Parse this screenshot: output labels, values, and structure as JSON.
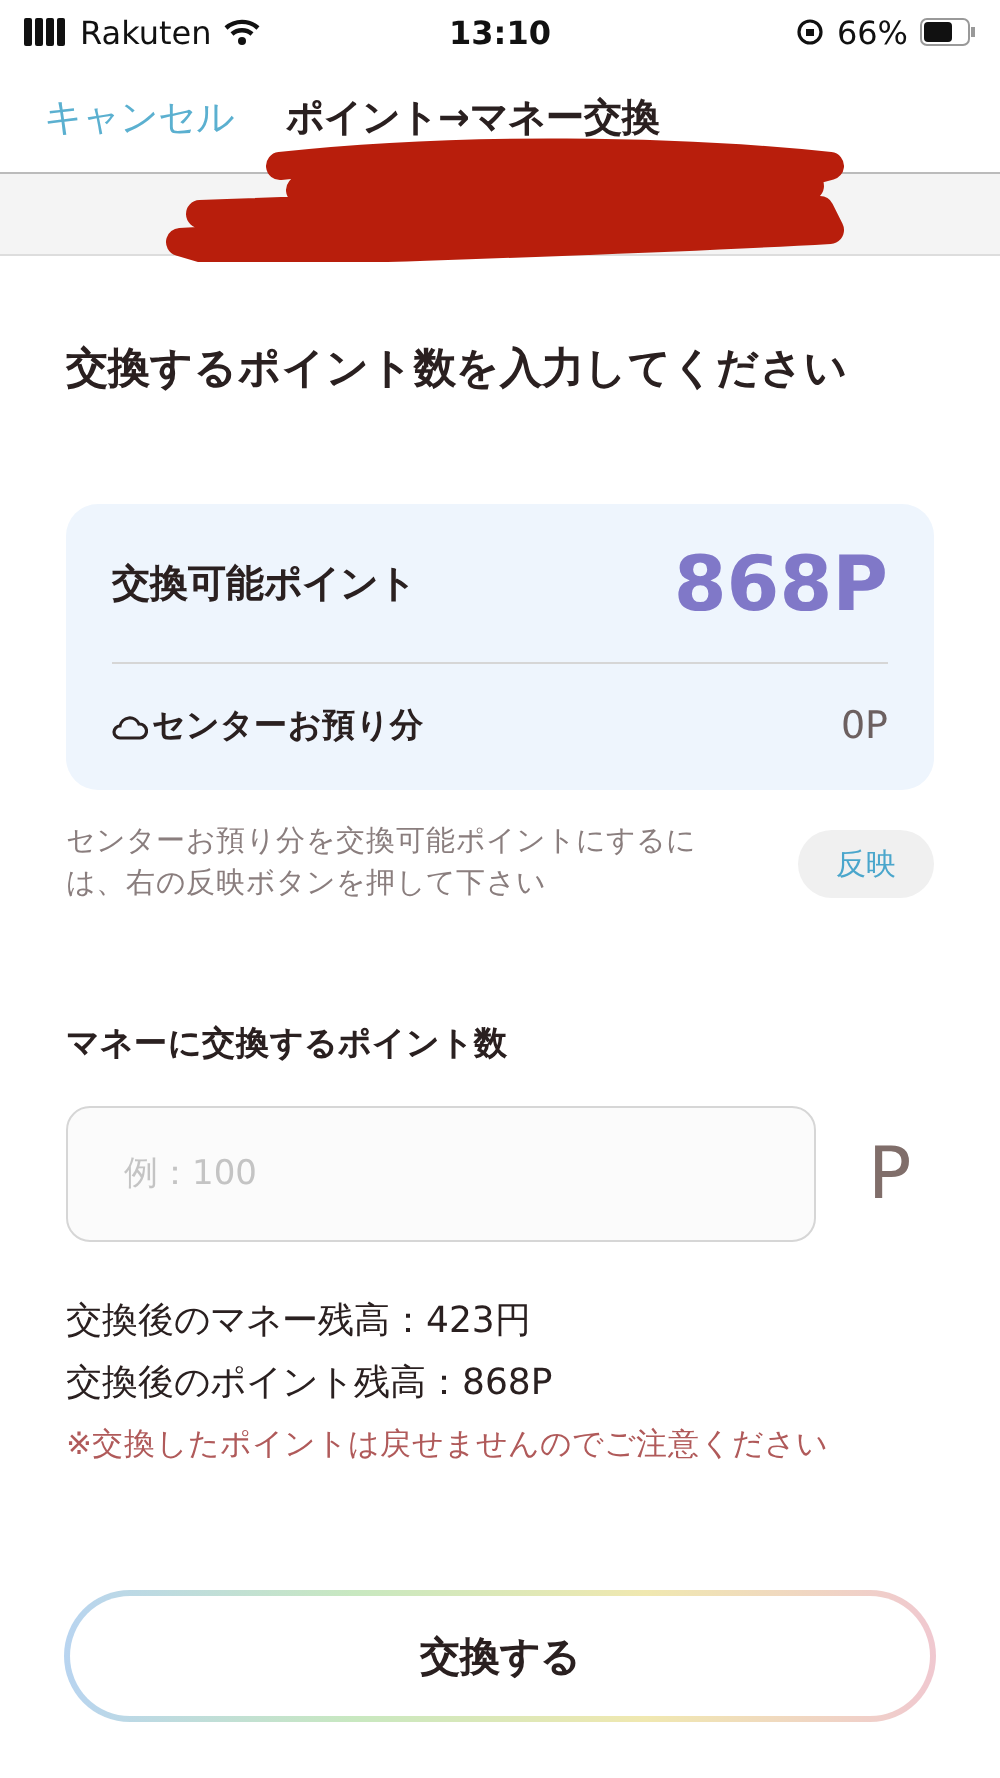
{
  "status_bar": {
    "carrier": "Rakuten",
    "time": "13:10",
    "battery": "66%"
  },
  "header": {
    "cancel": "キャンセル",
    "title": "ポイント→マネー交換"
  },
  "heading": "交換するポイント数を入力してください",
  "summary": {
    "available_label": "交換可能ポイント",
    "available_value": "868P",
    "center_label": "センターお預り分",
    "center_value": "0P"
  },
  "hint": "センターお預り分を交換可能ポイントにするには、右の反映ボタンを押して下さい",
  "reflect_button": "反映",
  "amount": {
    "label": "マネーに交換するポイント数",
    "placeholder": "例：100",
    "unit": "P"
  },
  "results": [
    "交換後のマネー残高：423円",
    "交換後のポイント残高：868P"
  ],
  "warning": "※交換したポイントは戻せませんのでご注意ください",
  "submit": "交換する"
}
